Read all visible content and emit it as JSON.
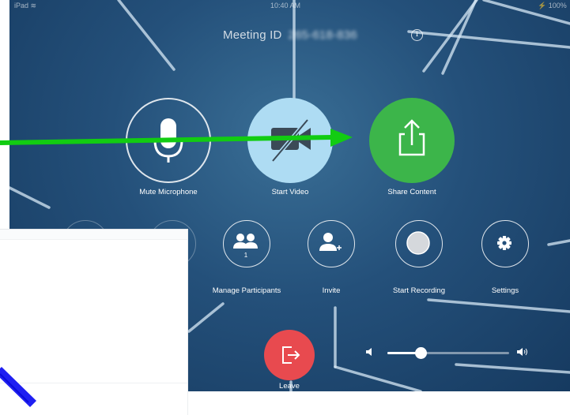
{
  "status_bar": {
    "left": "iPad ≋",
    "center": "10:40 AM",
    "right": "⚡ 100%"
  },
  "meeting": {
    "label": "Meeting ID",
    "id": "265-618-836"
  },
  "info_icon": "i",
  "main_buttons": [
    {
      "label": "Mute Microphone",
      "icon": "microphone-icon"
    },
    {
      "label": "Start Video",
      "icon": "video-off-icon"
    },
    {
      "label": "Share Content",
      "icon": "share-icon"
    }
  ],
  "secondary_buttons": [
    {
      "label": "Manage Participants",
      "icon": "participants-icon",
      "badge": "1"
    },
    {
      "label": "Invite",
      "icon": "add-user-icon"
    },
    {
      "label": "Start Recording",
      "icon": "record-icon"
    },
    {
      "label": "Settings",
      "icon": "gear-icon"
    }
  ],
  "leave": {
    "label": "Leave",
    "icon": "leave-icon"
  },
  "volume": {
    "level": 0.27,
    "low_icon": "speaker-low-icon",
    "high_icon": "speaker-high-icon"
  },
  "colors": {
    "background": "#24507a",
    "share": "#3cb54a",
    "video": "#aedcf3",
    "leave": "#e84a4f",
    "annotation_arrow": "#12cc12",
    "annotation_marker": "#1f1ff2"
  }
}
